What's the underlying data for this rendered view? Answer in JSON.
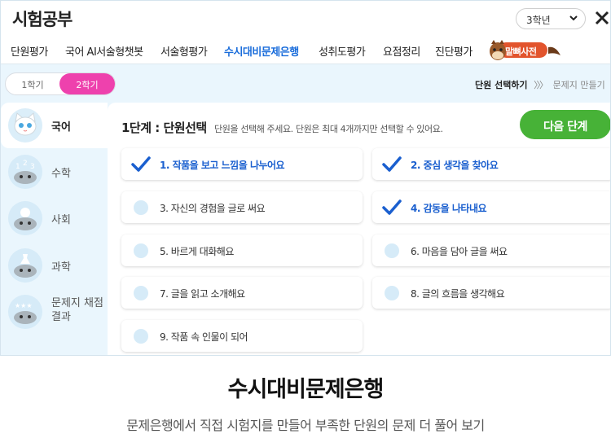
{
  "app": {
    "title": "시험공부"
  },
  "grade_select": {
    "value": "3학년"
  },
  "nav": {
    "items": [
      {
        "label": "단원평가",
        "active": false
      },
      {
        "label": "국어 AI서술형챗봇",
        "active": false
      },
      {
        "label": "서술형평가",
        "active": false
      },
      {
        "label": "수시대비문제은행",
        "active": true
      },
      {
        "label": "성취도평가",
        "active": false
      },
      {
        "label": "요점정리",
        "active": false
      },
      {
        "label": "진단평가",
        "active": false
      }
    ],
    "dictionary_label": "말뼈사전"
  },
  "semester": {
    "options": [
      "1학기",
      "2학기"
    ],
    "selected": "2학기"
  },
  "steps": {
    "current": "단원 선택하기",
    "separator": "〉〉〉",
    "next": "문제지 만들기"
  },
  "sidebar": {
    "items": [
      {
        "label": "국어",
        "active": true,
        "icon": "cat-icon"
      },
      {
        "label": "수학",
        "active": false,
        "icon": "numbers-icon"
      },
      {
        "label": "사회",
        "active": false,
        "icon": "globe-icon"
      },
      {
        "label": "과학",
        "active": false,
        "icon": "flask-icon"
      },
      {
        "label": "문제지 채점\n결과",
        "active": false,
        "icon": "stars-icon"
      }
    ]
  },
  "panel": {
    "title": "1단계 : 단원선택",
    "description": "단원을 선택해 주세요. 단원은 최대 4개까지만 선택할 수 있어요.",
    "next_button": "다음 단계"
  },
  "units": [
    {
      "label": "1. 작품을 보고 느낌을 나누어요",
      "selected": true
    },
    {
      "label": "2. 중심 생각을 찾아요",
      "selected": true
    },
    {
      "label": "3. 자신의 경험을 글로 써요",
      "selected": false
    },
    {
      "label": "4. 감동을 나타내요",
      "selected": true
    },
    {
      "label": "5. 바르게 대화해요",
      "selected": false
    },
    {
      "label": "6. 마음을 담아 글을 써요",
      "selected": false
    },
    {
      "label": "7. 글을 읽고 소개해요",
      "selected": false
    },
    {
      "label": "8. 글의 흐름을 생각해요",
      "selected": false
    },
    {
      "label": "9. 작품 속 인물이 되어",
      "selected": false
    }
  ],
  "caption": {
    "title": "수시대비문제은행",
    "subtitle": "문제은행에서 직접 시험지를 만들어 부족한 단원의 문제 더 풀어 보기"
  },
  "colors": {
    "accent_blue": "#1a5fcf",
    "semester_pink": "#ee41ad",
    "next_green": "#47b237",
    "dict_orange": "#e2542d"
  }
}
